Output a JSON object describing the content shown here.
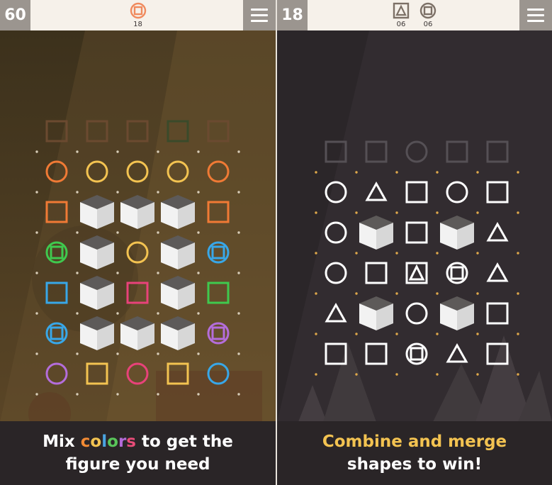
{
  "left": {
    "score": "60",
    "target_count": "18",
    "target_icon": "circle-square-icon",
    "target_color": "#f08a5d",
    "caption": {
      "prefix": "Mix ",
      "word_letters": [
        "c",
        "o",
        "l",
        "o",
        "r",
        "s"
      ],
      "suffix": " to get the",
      "line2": "figure you need"
    },
    "word_colors": [
      "#f28a34",
      "#f3c351",
      "#4aa3e0",
      "#59c65a",
      "#b36ad8",
      "#e84c78"
    ],
    "grid_colors": {
      "orange": "#f07a35",
      "yellow": "#f3c351",
      "green": "#3fc94e",
      "blue": "#38a7e8",
      "pink": "#e8427a",
      "purple": "#b46ddb",
      "ghost_brown": "#6b4a30",
      "ghost_green": "#3a4a2a"
    },
    "ghost_row": [
      "square",
      "square",
      "square",
      "square",
      "square"
    ],
    "ghost_colors": [
      "ghost_brown",
      "ghost_brown",
      "ghost_brown",
      "ghost_green",
      "ghost_brown"
    ],
    "grid": [
      [
        [
          "circle",
          "orange"
        ],
        [
          "circle",
          "yellow"
        ],
        [
          "circle",
          "yellow"
        ],
        [
          "circle",
          "yellow"
        ],
        [
          "circle",
          "orange"
        ]
      ],
      [
        [
          "square",
          "orange"
        ],
        [
          "block",
          ""
        ],
        [
          "block",
          ""
        ],
        [
          "block",
          ""
        ],
        [
          "square",
          "orange"
        ]
      ],
      [
        [
          "circle-square",
          "green"
        ],
        [
          "block",
          ""
        ],
        [
          "circle",
          "yellow"
        ],
        [
          "block",
          ""
        ],
        [
          "circle-square",
          "blue"
        ]
      ],
      [
        [
          "square",
          "blue"
        ],
        [
          "block",
          ""
        ],
        [
          "square",
          "pink"
        ],
        [
          "block",
          ""
        ],
        [
          "square",
          "green"
        ]
      ],
      [
        [
          "circle-square",
          "blue"
        ],
        [
          "block",
          ""
        ],
        [
          "block",
          ""
        ],
        [
          "block",
          ""
        ],
        [
          "circle-square",
          "purple"
        ]
      ],
      [
        [
          "circle",
          "purple"
        ],
        [
          "square",
          "yellow"
        ],
        [
          "circle",
          "pink"
        ],
        [
          "square",
          "yellow"
        ],
        [
          "circle",
          "blue"
        ]
      ]
    ]
  },
  "right": {
    "score": "18",
    "targets": [
      {
        "icon": "triangle-square-icon",
        "count": "06"
      },
      {
        "icon": "circle-square-icon",
        "count": "06"
      }
    ],
    "target_color": "#8a7d70",
    "caption": {
      "line1": "Combine and merge",
      "line2": "shapes to win!"
    },
    "ghost_row": [
      "square",
      "square",
      "circle",
      "square",
      "square"
    ],
    "grid": [
      [
        "circle",
        "triangle",
        "square",
        "circle",
        "square"
      ],
      [
        "circle",
        "block",
        "square",
        "block",
        "triangle"
      ],
      [
        "circle",
        "square",
        "triangle-square",
        "circle-square",
        "triangle"
      ],
      [
        "triangle",
        "block",
        "circle",
        "block",
        "square"
      ],
      [
        "square",
        "square",
        "circle-square",
        "triangle",
        "square"
      ]
    ],
    "dot_color": "#e0a94a"
  }
}
